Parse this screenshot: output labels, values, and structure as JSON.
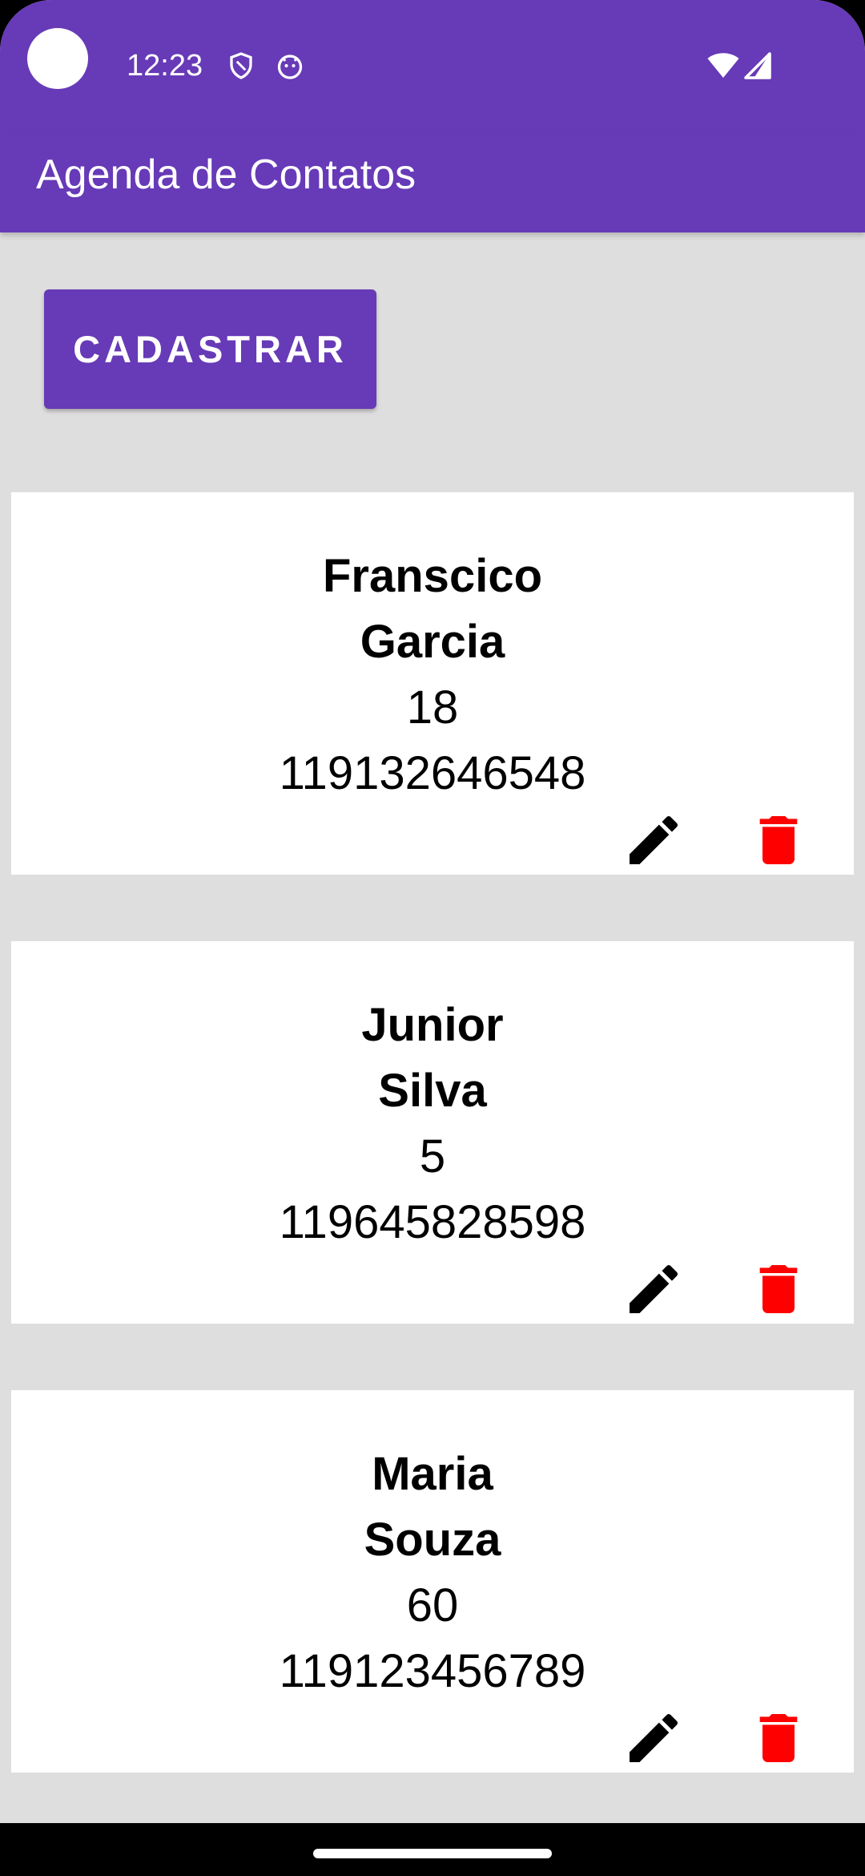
{
  "status_bar": {
    "time": "12:23",
    "icons": [
      "shield-icon",
      "android-face-icon",
      "wifi-icon",
      "signal-icon"
    ]
  },
  "app_bar": {
    "title": "Agenda de Contatos"
  },
  "add_button": {
    "label": "CADASTRAR"
  },
  "contacts": [
    {
      "first_name": "Franscico",
      "last_name": "Garcia",
      "age": "18",
      "phone": "119132646548"
    },
    {
      "first_name": "Junior",
      "last_name": "Silva",
      "age": "5",
      "phone": "119645828598"
    },
    {
      "first_name": "Maria",
      "last_name": "Souza",
      "age": "60",
      "phone": "119123456789"
    }
  ],
  "colors": {
    "primary": "#673ab7",
    "background": "#dedede",
    "card": "#ffffff",
    "delete": "#ff0000",
    "edit": "#000000"
  },
  "actions": {
    "edit_icon": "pencil-icon",
    "delete_icon": "trash-icon"
  }
}
